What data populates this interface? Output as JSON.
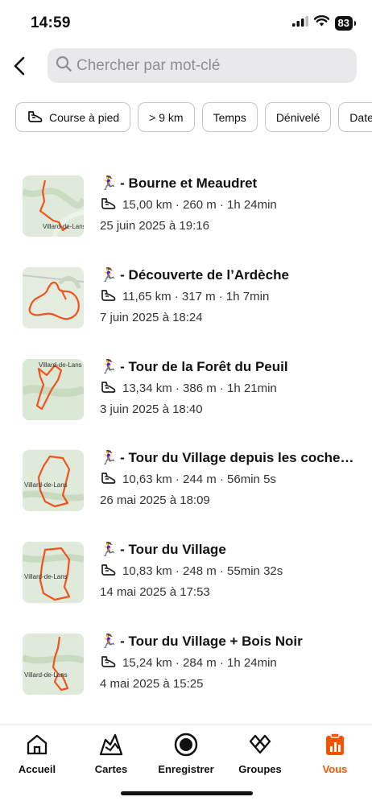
{
  "status_bar": {
    "time": "14:59",
    "battery": "83"
  },
  "search": {
    "placeholder": "Chercher par mot-clé"
  },
  "filters": [
    {
      "label": "Course à pied",
      "icon": "shoe-icon"
    },
    {
      "label": "> 9 km"
    },
    {
      "label": "Temps"
    },
    {
      "label": "Dénivelé"
    },
    {
      "label": "Date"
    }
  ],
  "activities": [
    {
      "emoji": "🏃‍♀️",
      "title": "- Bourne et Meaudret",
      "stats": "15,00 km · 260 m · 1h 24min",
      "date": "25 juin 2025 à 19:16",
      "map_label": "Villard-de-Lans"
    },
    {
      "emoji": "🏃‍♀️",
      "title": "- Découverte de l’Ardèche",
      "stats": "11,65 km · 317 m · 1h 7min",
      "date": "7 juin 2025 à 18:24",
      "map_label": ""
    },
    {
      "emoji": "🏃‍♀️",
      "title": "- Tour de la Forêt du Peuil",
      "stats": "13,34 km · 386 m · 1h 21min",
      "date": "3 juin 2025 à 18:40",
      "map_label": "Villard-de-Lans"
    },
    {
      "emoji": "🏃‍♀️",
      "title": "- Tour du Village depuis les coche…",
      "stats": "10,63 km · 244 m · 56min 5s",
      "date": "26 mai 2025 à 18:09",
      "map_label": "Villard-de-Lans"
    },
    {
      "emoji": "🏃‍♀️",
      "title": "- Tour du Village",
      "stats": "10,83 km · 248 m · 55min 32s",
      "date": "14 mai 2025 à 17:53",
      "map_label": "Villard-de-Lans"
    },
    {
      "emoji": "🏃‍♀️",
      "title": "- Tour du Village + Bois Noir",
      "stats": "15,24 km · 284 m · 1h 24min",
      "date": "4 mai 2025 à 15:25",
      "map_label": "Villard-de-Lans"
    }
  ],
  "tabs": [
    {
      "label": "Accueil",
      "icon": "home-icon"
    },
    {
      "label": "Cartes",
      "icon": "map-icon"
    },
    {
      "label": "Enregistrer",
      "icon": "record-icon"
    },
    {
      "label": "Groupes",
      "icon": "groups-icon"
    },
    {
      "label": "Vous",
      "icon": "stats-icon",
      "active": true
    }
  ],
  "colors": {
    "accent": "#fc5200",
    "route": "#f0531c",
    "map_bg": "#dfeadb"
  }
}
